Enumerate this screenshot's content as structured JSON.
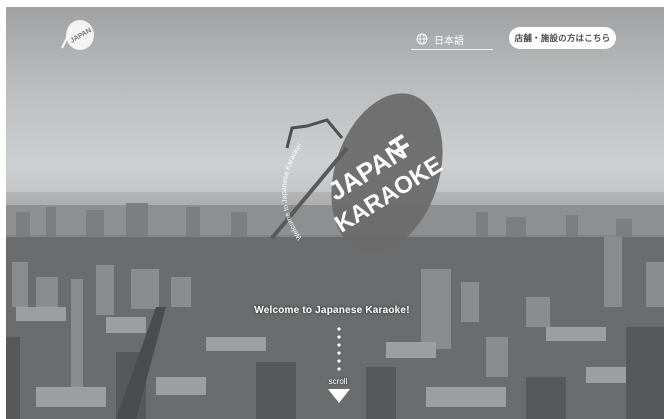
{
  "header": {
    "logo_text": "JAPAN KARAOKE",
    "language": {
      "icon": "globe-icon",
      "label": "日本語"
    },
    "store_button_label": "店舗・施設の方はこちら"
  },
  "hero": {
    "logo_text_line1": "JAPAN",
    "logo_text_line2": "KARAOKE",
    "logo_arc_text": "Welcome to Japanese Karaoke!",
    "welcome_text": "Welcome to Japanese Karaoke!",
    "scroll_label": "scroll"
  },
  "colors": {
    "logo_fill": "#6b6b6b",
    "button_bg": "#ffffff",
    "text": "#ffffff"
  }
}
